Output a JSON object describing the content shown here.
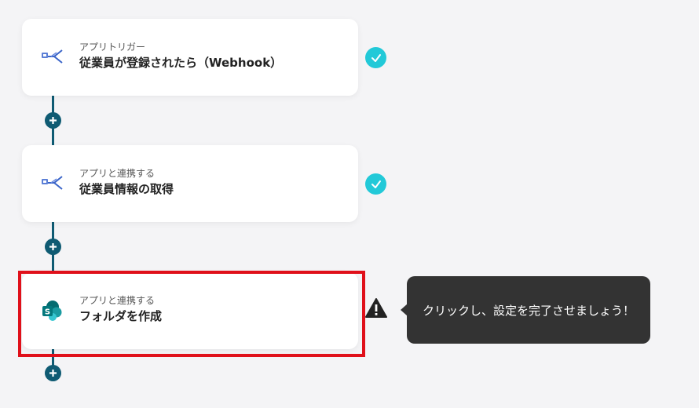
{
  "steps": [
    {
      "subtitle": "アプリトリガー",
      "title": "従業員が登録されたら（Webhook）",
      "icon": "employee-app-icon",
      "status": "completed"
    },
    {
      "subtitle": "アプリと連携する",
      "title": "従業員情報の取得",
      "icon": "employee-app-icon",
      "status": "completed"
    },
    {
      "subtitle": "アプリと連携する",
      "title": "フォルダを作成",
      "icon": "sharepoint-icon",
      "status": "warning"
    }
  ],
  "tooltip": {
    "text": "クリックし、設定を完了させましょう！"
  },
  "colors": {
    "connector": "#0f5b73",
    "check": "#22c9d8",
    "highlight": "#e0101a",
    "tooltip_bg": "#333333"
  }
}
